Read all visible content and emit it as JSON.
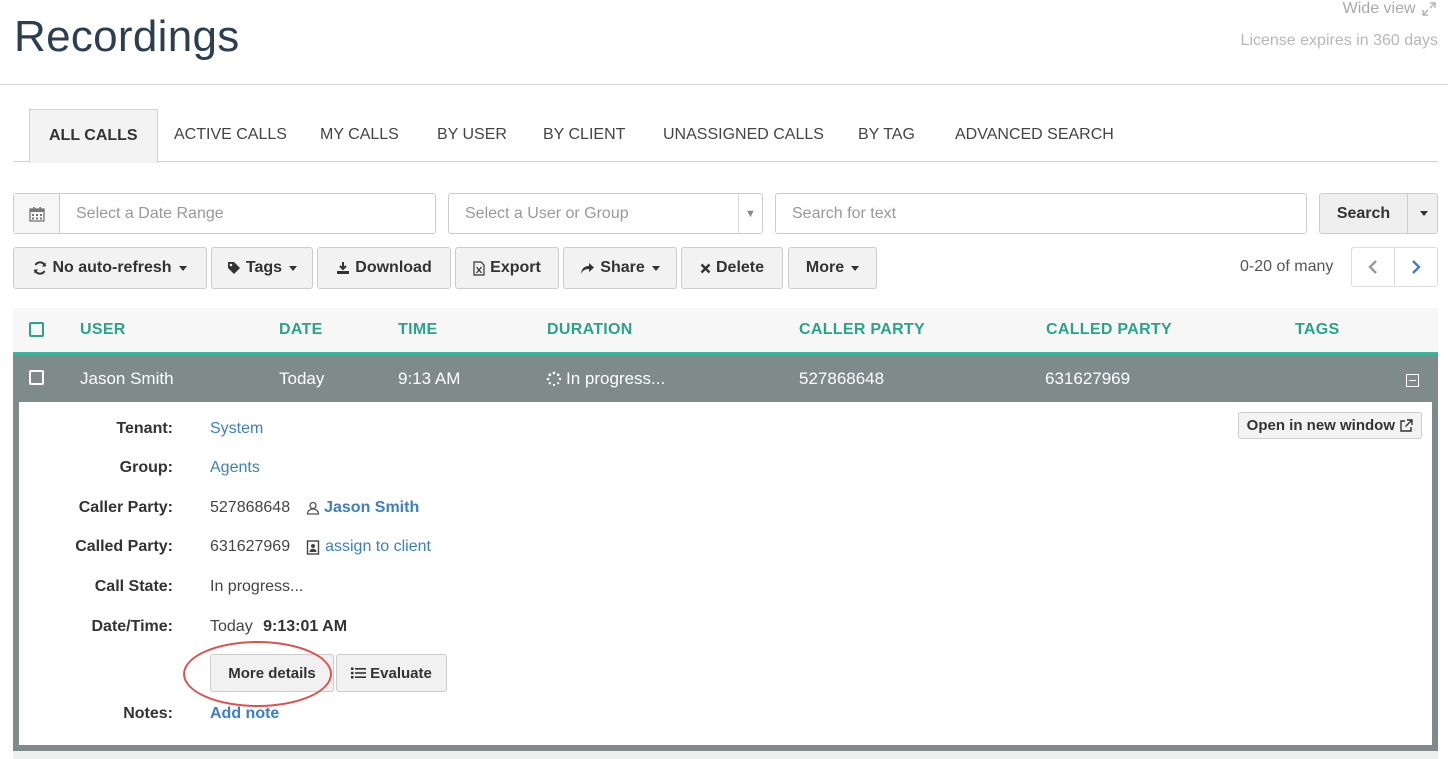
{
  "header": {
    "title": "Recordings",
    "wide_view": "Wide view",
    "license": "License expires in 360 days"
  },
  "tabs": [
    {
      "label": "ALL CALLS",
      "active": true
    },
    {
      "label": "ACTIVE CALLS"
    },
    {
      "label": "MY CALLS"
    },
    {
      "label": "BY USER"
    },
    {
      "label": "BY CLIENT"
    },
    {
      "label": "UNASSIGNED CALLS"
    },
    {
      "label": "BY TAG"
    },
    {
      "label": "ADVANCED SEARCH"
    }
  ],
  "filters": {
    "date_placeholder": "Select a Date Range",
    "user_placeholder": "Select a User or Group",
    "text_placeholder": "Search for text",
    "search_label": "Search"
  },
  "toolbar": {
    "refresh": "No auto-refresh",
    "tags": "Tags",
    "download": "Download",
    "export": "Export",
    "share": "Share",
    "delete": "Delete",
    "more": "More",
    "paging": "0-20 of many"
  },
  "table": {
    "headers": [
      "USER",
      "DATE",
      "TIME",
      "DURATION",
      "CALLER PARTY",
      "CALLED PARTY",
      "TAGS"
    ],
    "row": {
      "user": "Jason Smith",
      "date": "Today",
      "time": "9:13 AM",
      "duration": "In progress...",
      "caller": "527868648",
      "called": "631627969"
    }
  },
  "detail": {
    "open_window": "Open in new window",
    "tenant_label": "Tenant:",
    "tenant_value": "System",
    "group_label": "Group:",
    "group_value": "Agents",
    "caller_label": "Caller Party:",
    "caller_number": "527868648",
    "caller_user": "Jason Smith",
    "called_label": "Called Party:",
    "called_number": "631627969",
    "assign_client": "assign to client",
    "state_label": "Call State:",
    "state_value": "In progress...",
    "datetime_label": "Date/Time:",
    "date_value": "Today",
    "time_value": "9:13:01 AM",
    "more_details": "More details",
    "evaluate": "Evaluate",
    "notes_label": "Notes:",
    "add_note": "Add note"
  },
  "colors": {
    "accent": "#2aa487",
    "row_bg": "#7f8a8b",
    "link": "#3d7fc1",
    "highlight": "#d9534f"
  }
}
